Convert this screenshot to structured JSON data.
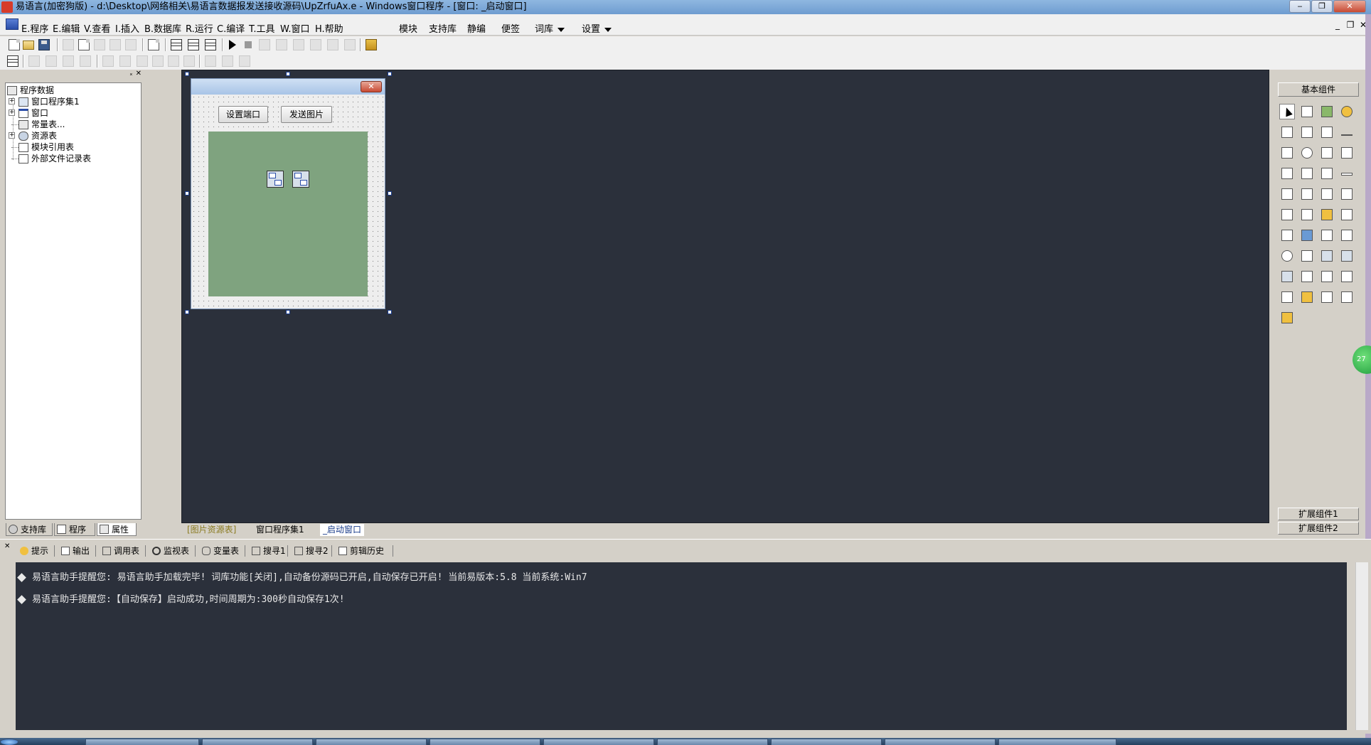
{
  "window": {
    "title": "易语言(加密狗版) - d:\\Desktop\\网络相关\\易语言数据报发送接收源码\\UpZrfuAx.e - Windows窗口程序 - [窗口: _启动窗口]",
    "minimize": "‒",
    "restore": "❐",
    "close": "✕"
  },
  "menu": {
    "items": [
      "E.程序",
      "E.编辑",
      "V.查看",
      "I.插入",
      "B.数据库",
      "R.运行",
      "C.编译",
      "T.工具",
      "W.窗口",
      "H.帮助"
    ],
    "extras": [
      "模块",
      "支持库",
      "静编",
      "便签",
      "词库",
      "设置"
    ],
    "mdi": [
      "_",
      "❐",
      "✕"
    ]
  },
  "left_panel": {
    "pin": "ₓ",
    "close": "✕",
    "tree": [
      {
        "label": "程序数据",
        "icon": "tree-root-icon"
      },
      {
        "label": "窗口程序集1",
        "icon": "module-icon"
      },
      {
        "label": "窗口",
        "icon": "window-icon"
      },
      {
        "label": "常量表...",
        "icon": "constant-icon"
      },
      {
        "label": "资源表",
        "icon": "resource-icon"
      },
      {
        "label": "模块引用表",
        "icon": "module-ref-icon"
      },
      {
        "label": "外部文件记录表",
        "icon": "external-file-icon"
      }
    ],
    "tabs": [
      "支持库",
      "程序",
      "属性"
    ]
  },
  "form": {
    "close_glyph": "✕",
    "buttons": [
      "设置端口",
      "发送图片"
    ]
  },
  "doc_tabs": [
    "[图片资源表]",
    "窗口程序集1",
    "_启动窗口"
  ],
  "right_panel": {
    "header": "基本组件",
    "ext1": "扩展组件1",
    "ext2": "扩展组件2"
  },
  "floatball": {
    "text": "27"
  },
  "bottom_panel": {
    "close": "✕",
    "tabs": [
      "提示",
      "输出",
      "调用表",
      "监视表",
      "变量表",
      "搜寻1",
      "搜寻2",
      "剪辑历史"
    ],
    "output_lines": [
      "易语言助手提醒您:  易语言助手加载完毕!  词库功能[关闭],自动备份源码已开启,自动保存已开启!  当前易版本:5.8  当前系统:Win7",
      "易语言助手提醒您:【自动保存】启动成功,时间周期为:300秒自动保存1次!"
    ]
  },
  "colors": {
    "workspace": "#2b303b",
    "panel": "#d4d0c8",
    "picturebox": "#7fa37f",
    "titlebar": "#7fa8d8"
  }
}
